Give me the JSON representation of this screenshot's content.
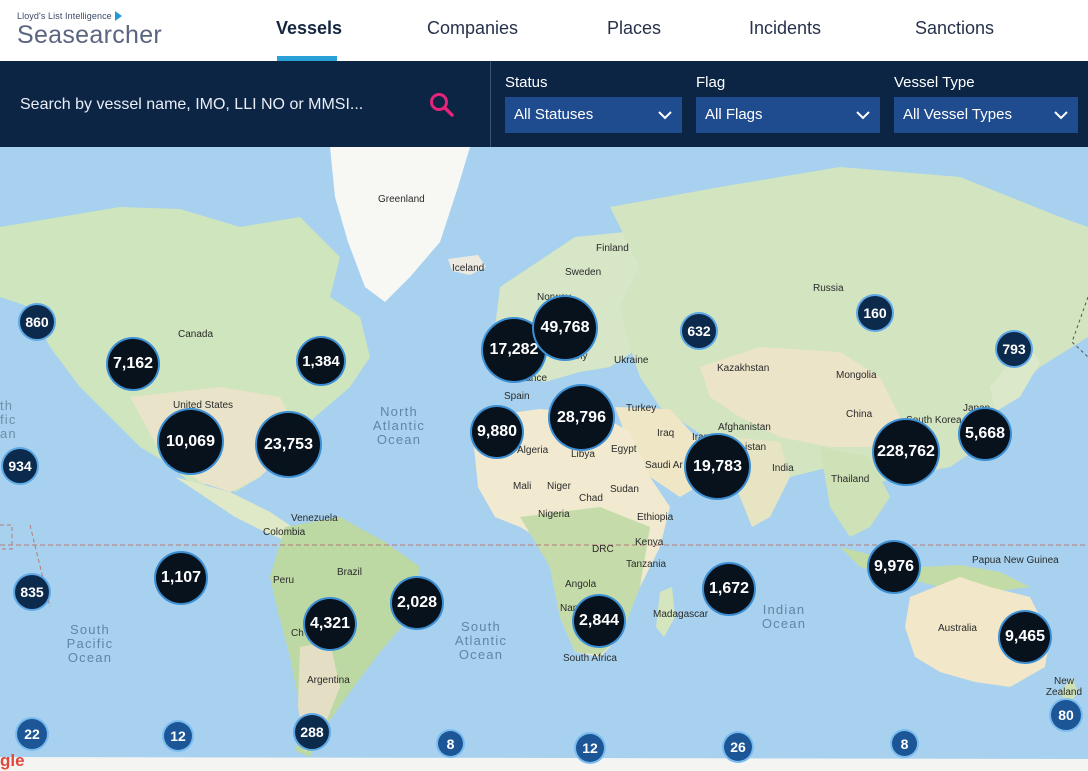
{
  "header": {
    "logo_small": "Lloyd's List Intelligence",
    "logo_big": "Seasearcher",
    "nav": [
      {
        "label": "Vessels",
        "active": true
      },
      {
        "label": "Companies",
        "active": false
      },
      {
        "label": "Places",
        "active": false
      },
      {
        "label": "Incidents",
        "active": false
      },
      {
        "label": "Sanctions",
        "active": false
      }
    ]
  },
  "search": {
    "placeholder": "Search by vessel name, IMO, LLI NO or MMSI..."
  },
  "filters": {
    "status": {
      "label": "Status",
      "value": "All Statuses"
    },
    "flag": {
      "label": "Flag",
      "value": "All Flags"
    },
    "vessel_type": {
      "label": "Vessel Type",
      "value": "All Vessel Types"
    }
  },
  "map": {
    "places": {
      "greenland": "Greenland",
      "iceland": "Iceland",
      "finland": "Finland",
      "sweden": "Sweden",
      "norway": "Norway",
      "russia": "Russia",
      "ukraine": "Ukraine",
      "kazakhstan": "Kazakhstan",
      "mongolia": "Mongolia",
      "china": "China",
      "south_korea": "South Korea",
      "japan": "Japan",
      "canada": "Canada",
      "united_states": "United States",
      "spain": "Spain",
      "france": "rance",
      "germany": "many",
      "turkey": "Turkey",
      "afghanistan": "Afghanistan",
      "iraq": "Iraq",
      "iran": "Iran",
      "pakistan": "istan",
      "india": "India",
      "saudi": "Saudi Ar",
      "egypt": "Egypt",
      "libya": "Libya",
      "algeria": "Algeria",
      "mali": "Mali",
      "niger": "Niger",
      "chad": "Chad",
      "sudan": "Sudan",
      "nigeria": "Nigeria",
      "ethiopia": "Ethiopia",
      "kenya": "Kenya",
      "drc": "DRC",
      "tanzania": "Tanzania",
      "angola": "Angola",
      "namibia": "Nam",
      "madagascar": "Madagascar",
      "south_africa": "South Africa",
      "thailand": "Thailand",
      "venezuela": "Venezuela",
      "colombia": "Colombia",
      "peru": "Peru",
      "brazil": "Brazil",
      "chile": "Ch",
      "argentina": "Argentina",
      "png": "Papua New Guinea",
      "australia": "Australia",
      "new_zealand": "New Zealand",
      "pacific_fragment": "th fic an"
    },
    "oceans": {
      "north_atlantic": "North Atlantic Ocean",
      "south_atlantic": "South Atlantic Ocean",
      "south_pacific": "South Pacific Ocean",
      "indian": "Indian Ocean"
    },
    "clusters": [
      "860",
      "7,162",
      "1,384",
      "17,282",
      "49,768",
      "632",
      "160",
      "793",
      "10,069",
      "23,753",
      "9,880",
      "28,796",
      "19,783",
      "228,762",
      "5,668",
      "934",
      "1,107",
      "2,028",
      "4,321",
      "835",
      "2,844",
      "1,672",
      "9,976",
      "9,465",
      "22",
      "12",
      "288",
      "8",
      "12",
      "26",
      "8",
      "80"
    ],
    "google_fragment": "gle"
  }
}
